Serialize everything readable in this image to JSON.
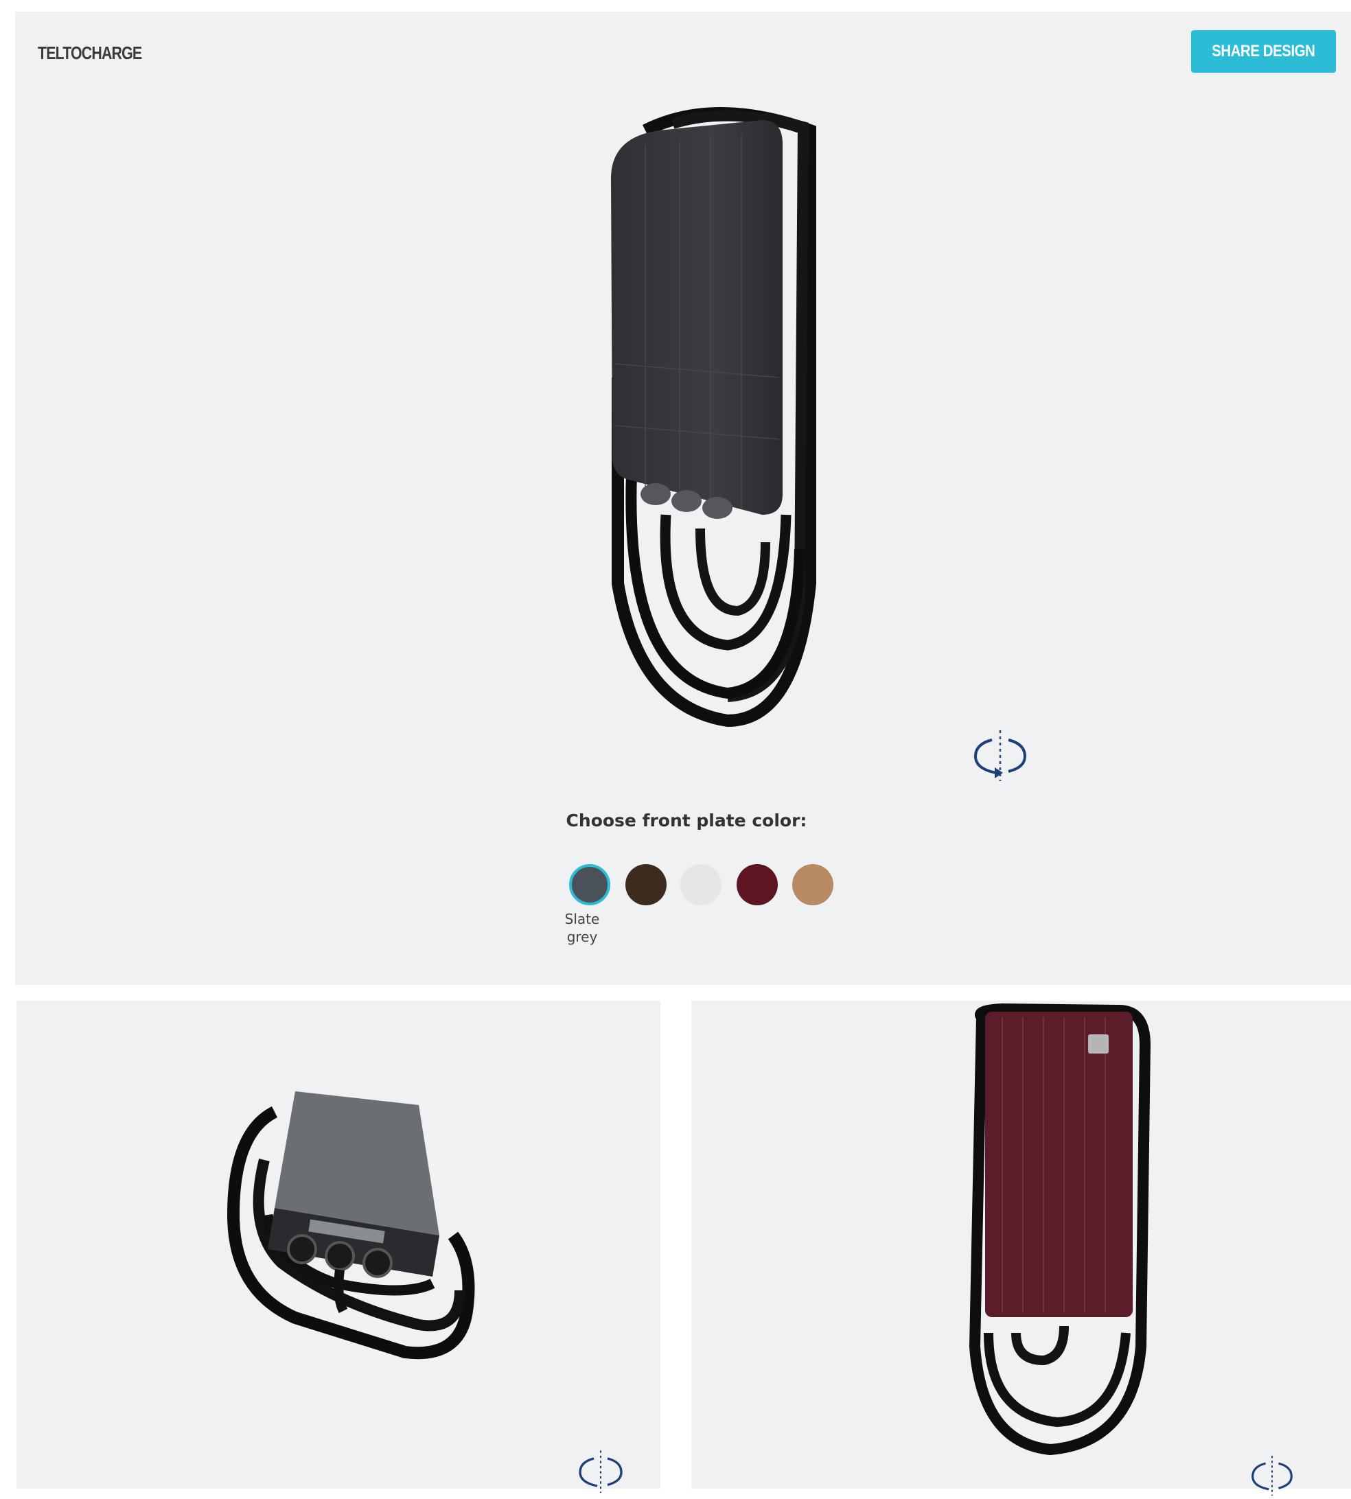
{
  "header": {
    "brand": "TELTOCHARGE",
    "share_label": "SHARE DESIGN",
    "accent_color": "#2cbcd6"
  },
  "configurator": {
    "color_title": "Choose front plate color:",
    "selected_label": "Slate grey",
    "swatches": [
      {
        "color": "#4b5158",
        "selected": true
      },
      {
        "color": "#3d2b20"
      },
      {
        "color": "#e6e6e6"
      },
      {
        "color": "#5e1522"
      },
      {
        "color": "#b88a62"
      }
    ]
  },
  "icons": {
    "rotate": "rotate-360-icon"
  }
}
